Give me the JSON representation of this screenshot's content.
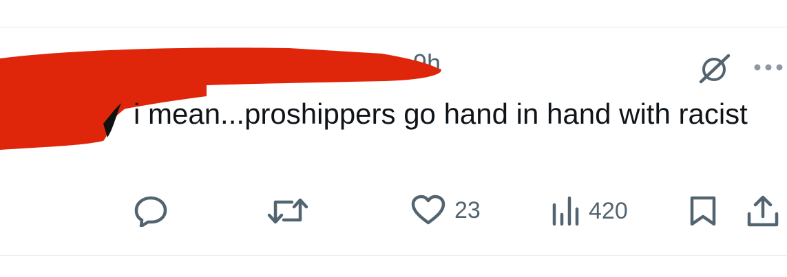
{
  "tweet": {
    "timestamp": "9h",
    "text": "i mean...proshippers go hand in hand with racist",
    "actions": {
      "like_count": "23",
      "views_count": "420"
    },
    "icons": {
      "grok": "grok-icon",
      "more": "more-options-icon",
      "reply": "reply-icon",
      "retweet": "retweet-icon",
      "like": "heart-icon",
      "views": "views-icon",
      "bookmark": "bookmark-icon",
      "share": "share-icon"
    },
    "colors": {
      "text": "#0f1419",
      "secondary": "#536471",
      "redaction": "#e0260a"
    }
  }
}
